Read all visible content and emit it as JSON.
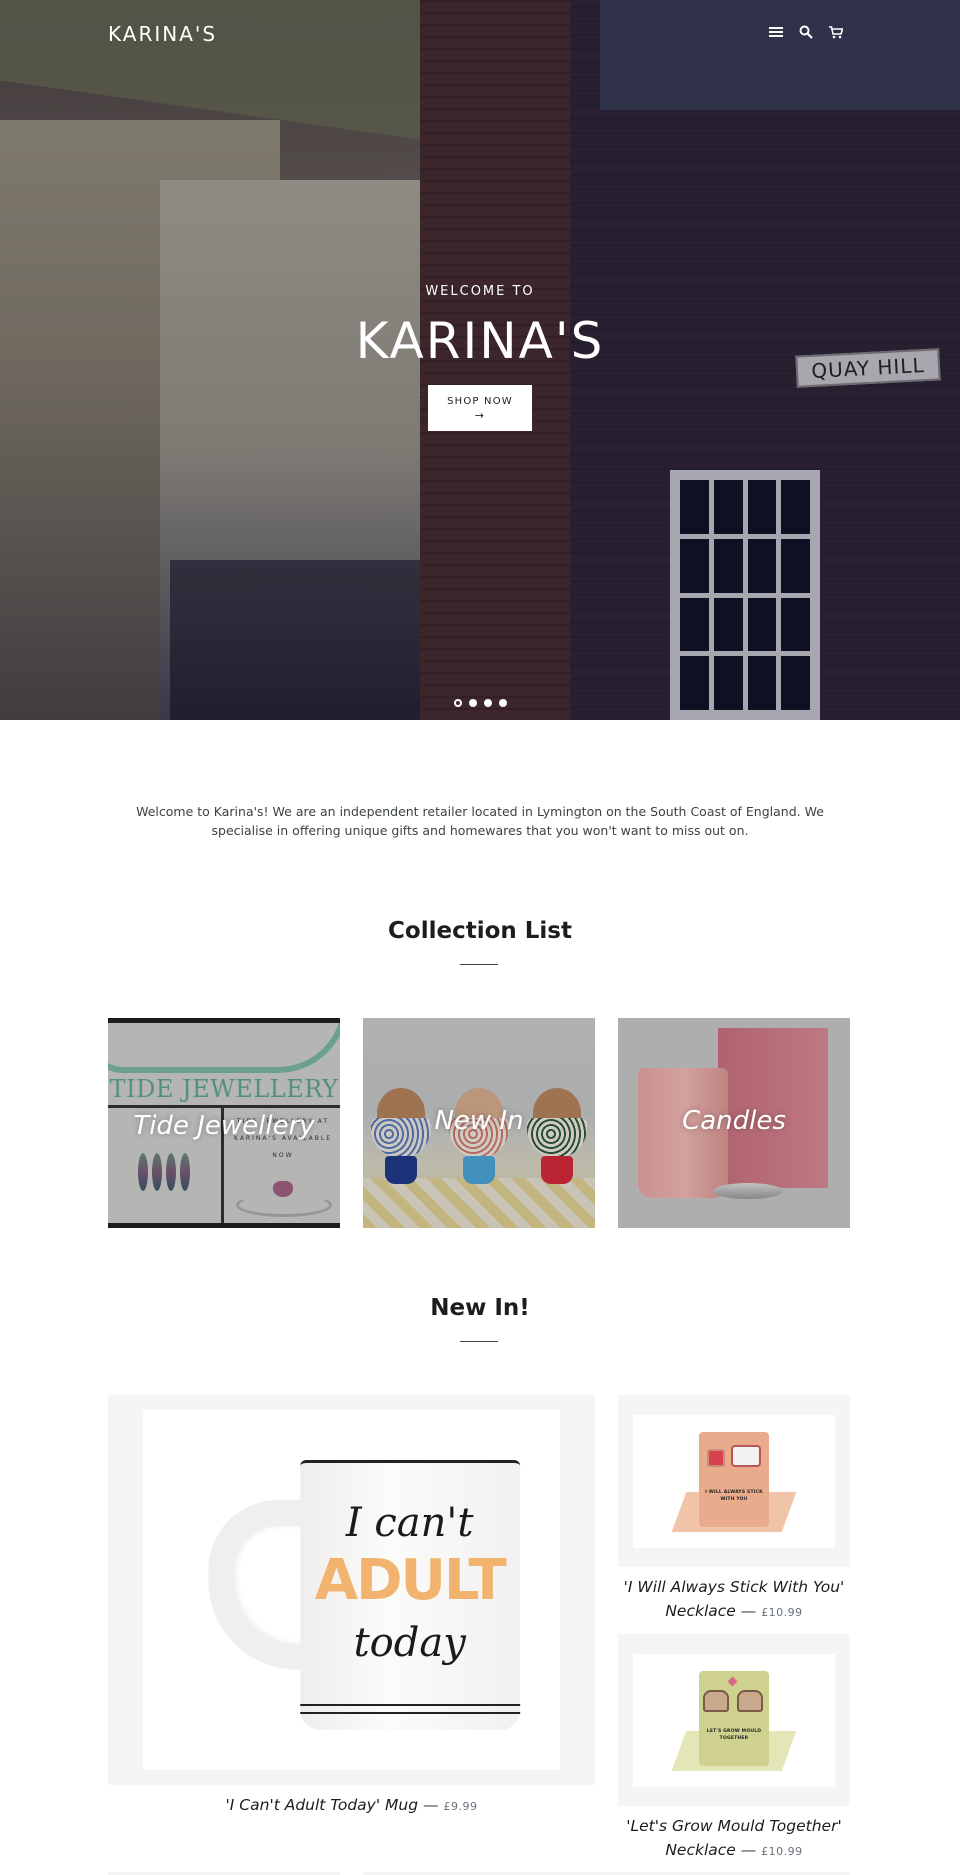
{
  "header": {
    "logo": "KARINA'S",
    "icons": [
      "menu-icon",
      "search-icon",
      "cart-icon"
    ]
  },
  "hero": {
    "kicker": "WELCOME TO",
    "title": "KARINA'S",
    "button_label": "SHOP NOW",
    "button_arrow": "→",
    "sign_text": "QUAY HILL",
    "slides": 4,
    "active_slide": 1
  },
  "intro": {
    "text": "Welcome to Karina's!  We are an independent retailer located in Lymington on the South Coast of England. We specialise in offering unique gifts and homewares that you won't want to miss out on."
  },
  "collections": {
    "title": "Collection List",
    "items": [
      {
        "label": "Tide Jewellery",
        "image_text": "TIDE JEWELLERY",
        "image_subtext": "TIDE JEWELLERY AT KARINA'S AVAILABLE NOW"
      },
      {
        "label": "New In"
      },
      {
        "label": "Candles"
      }
    ]
  },
  "new_in": {
    "title": "New In!",
    "products": [
      {
        "name": "'I Can't Adult Today' Mug",
        "price": "£9.99",
        "image_text": [
          "I can't",
          "ADULT",
          "today"
        ]
      },
      {
        "name": "'I Will Always Stick With You' Necklace",
        "name_line1": "'I Will Always Stick With You'",
        "name_line2": "Necklace",
        "price": "£10.99",
        "image_text": "I WILL ALWAYS STICK WITH YOU"
      },
      {
        "name": "'Let's Grow Mould Together' Necklace",
        "name_line1": "'Let's Grow Mould Together'",
        "name_line2": "Necklace",
        "price": "£10.99",
        "image_text": "LET'S GROW MOULD TOGETHER"
      }
    ],
    "dash": "—"
  },
  "colors": {
    "text": "#1c1d1d",
    "muted": "#69727b",
    "frame_bg": "#f5f5f5",
    "white": "#ffffff"
  }
}
